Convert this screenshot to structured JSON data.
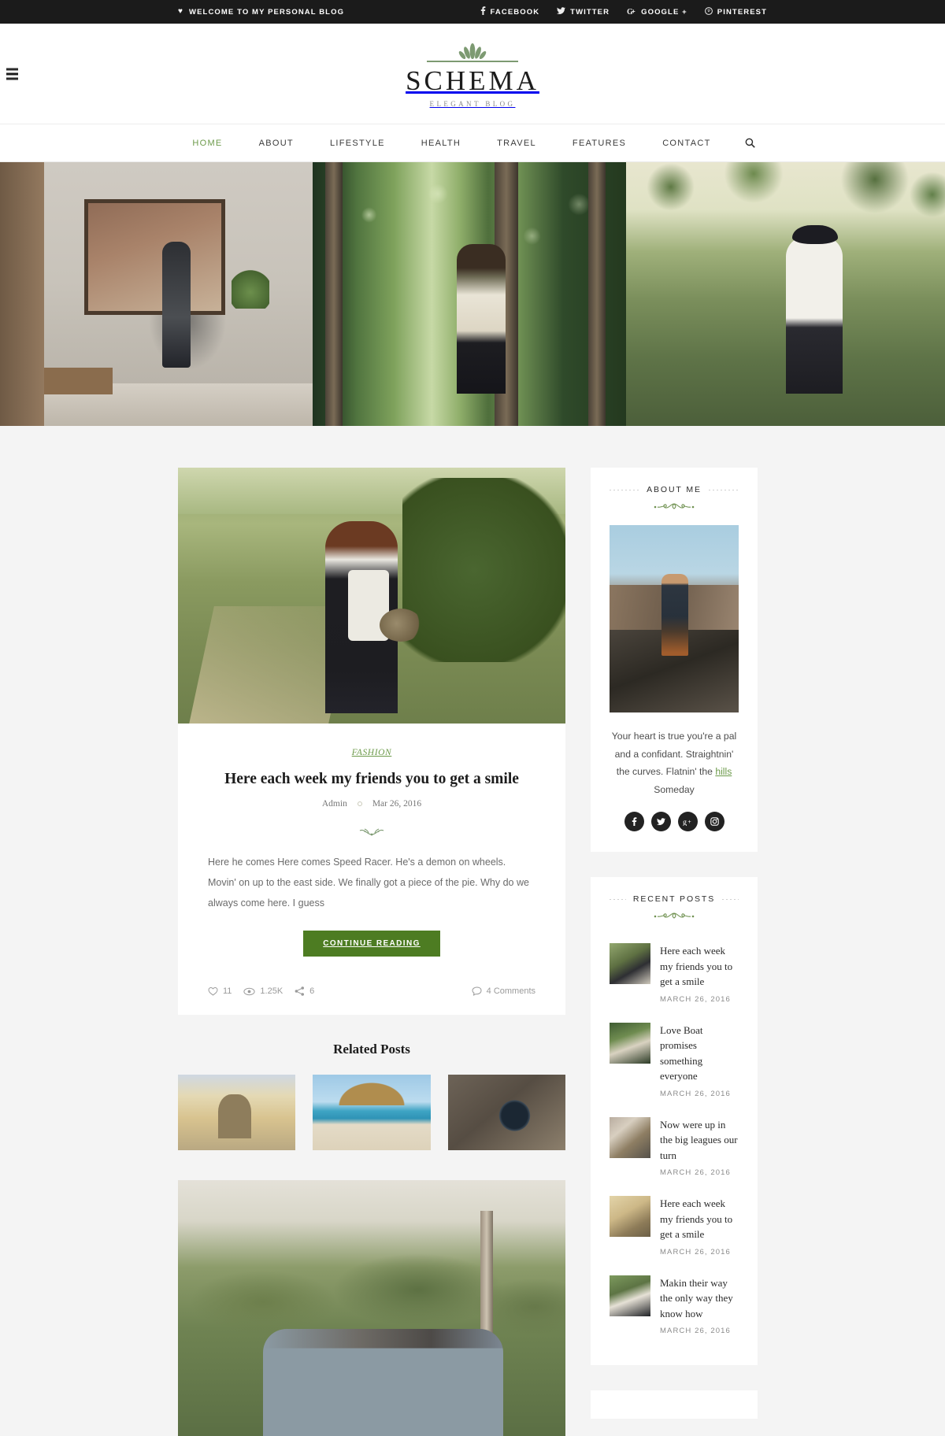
{
  "topbar": {
    "heart_icon": "heart-icon",
    "welcome": "WELCOME TO MY PERSONAL BLOG",
    "socials": [
      {
        "name": "FACEBOOK",
        "icon": "facebook-icon",
        "glyph": "f"
      },
      {
        "name": "TWITTER",
        "icon": "twitter-icon",
        "glyph": "ᴠ"
      },
      {
        "name": "GOOGLE +",
        "icon": "google-plus-icon",
        "glyph": "g"
      },
      {
        "name": "PINTEREST",
        "icon": "pinterest-icon",
        "glyph": "ⓟ"
      }
    ]
  },
  "header": {
    "menu_icon": "hamburger-menu-icon",
    "logo_name": "SCHEMA",
    "logo_tagline": "ELEGANT BLOG"
  },
  "nav": {
    "items": [
      {
        "label": "HOME",
        "active": true
      },
      {
        "label": "ABOUT",
        "active": false
      },
      {
        "label": "LIFESTYLE",
        "active": false
      },
      {
        "label": "HEALTH",
        "active": false
      },
      {
        "label": "TRAVEL",
        "active": false
      },
      {
        "label": "FEATURES",
        "active": false
      },
      {
        "label": "CONTACT",
        "active": false
      }
    ],
    "search_icon": "search-icon"
  },
  "hero": {
    "slides": [
      {
        "alt": "woman standing by window in loft apartment"
      },
      {
        "alt": "woman with backpack hiking in forest"
      },
      {
        "alt": "blonde woman in hat standing in a field"
      }
    ]
  },
  "post": {
    "image_alt": "woman holding pine cones on a field path",
    "category": "FASHION",
    "title": "Here each week my friends you to get a smile",
    "author": "Admin",
    "date": "Mar 26, 2016",
    "excerpt": "Here he comes Here comes Speed Racer. He's a demon on wheels. Movin' on up to the east side. We finally got a piece of the pie. Why do we always come here. I guess",
    "continue_label": "CONTINUE READING",
    "likes": "11",
    "views": "1.25K",
    "shares": "6",
    "comments": "4 Comments"
  },
  "related": {
    "title": "Related Posts",
    "items": [
      {
        "alt": "people walking under a yellow stone arch",
        "class": "rel-arch"
      },
      {
        "alt": "woman sitting under a beach umbrella",
        "class": "rel-beach"
      },
      {
        "alt": "person holding a camera over autumn leaves",
        "class": "rel-camera"
      }
    ]
  },
  "next_post": {
    "image_alt": "group of men standing on a hillside"
  },
  "sidebar": {
    "about": {
      "title": "ABOUT ME",
      "image_alt": "man sitting on volcanic rocks",
      "text_part1": "Your heart is true you're a pal and a confidant. Straightnin' the curves. Flatnin' the ",
      "text_highlight": "hills",
      "text_part2": " Someday",
      "socials": [
        {
          "name": "facebook-icon",
          "glyph": "f"
        },
        {
          "name": "twitter-icon",
          "glyph": "ᴠ"
        },
        {
          "name": "google-plus-icon",
          "glyph": "g"
        },
        {
          "name": "instagram-icon",
          "glyph": "◉"
        }
      ]
    },
    "recent": {
      "title": "RECENT POSTS",
      "items": [
        {
          "title": "Here each week my friends you to get a smile",
          "date": "MARCH 26, 2016",
          "thumb": "rt1"
        },
        {
          "title": "Love Boat promises something everyone",
          "date": "MARCH 26, 2016",
          "thumb": "rt2"
        },
        {
          "title": "Now were up in the big leagues our turn",
          "date": "MARCH 26, 2016",
          "thumb": "rt3"
        },
        {
          "title": "Here each week my friends you to get a smile",
          "date": "MARCH 26, 2016",
          "thumb": "rt4"
        },
        {
          "title": "Makin their way the only way they know how",
          "date": "MARCH 26, 2016",
          "thumb": "rt5"
        }
      ]
    }
  },
  "colors": {
    "accent_green": "#6c9a4a",
    "button_green": "#4d7c22",
    "topbar_bg": "#1b1b1b",
    "page_bg": "#f4f4f4"
  }
}
